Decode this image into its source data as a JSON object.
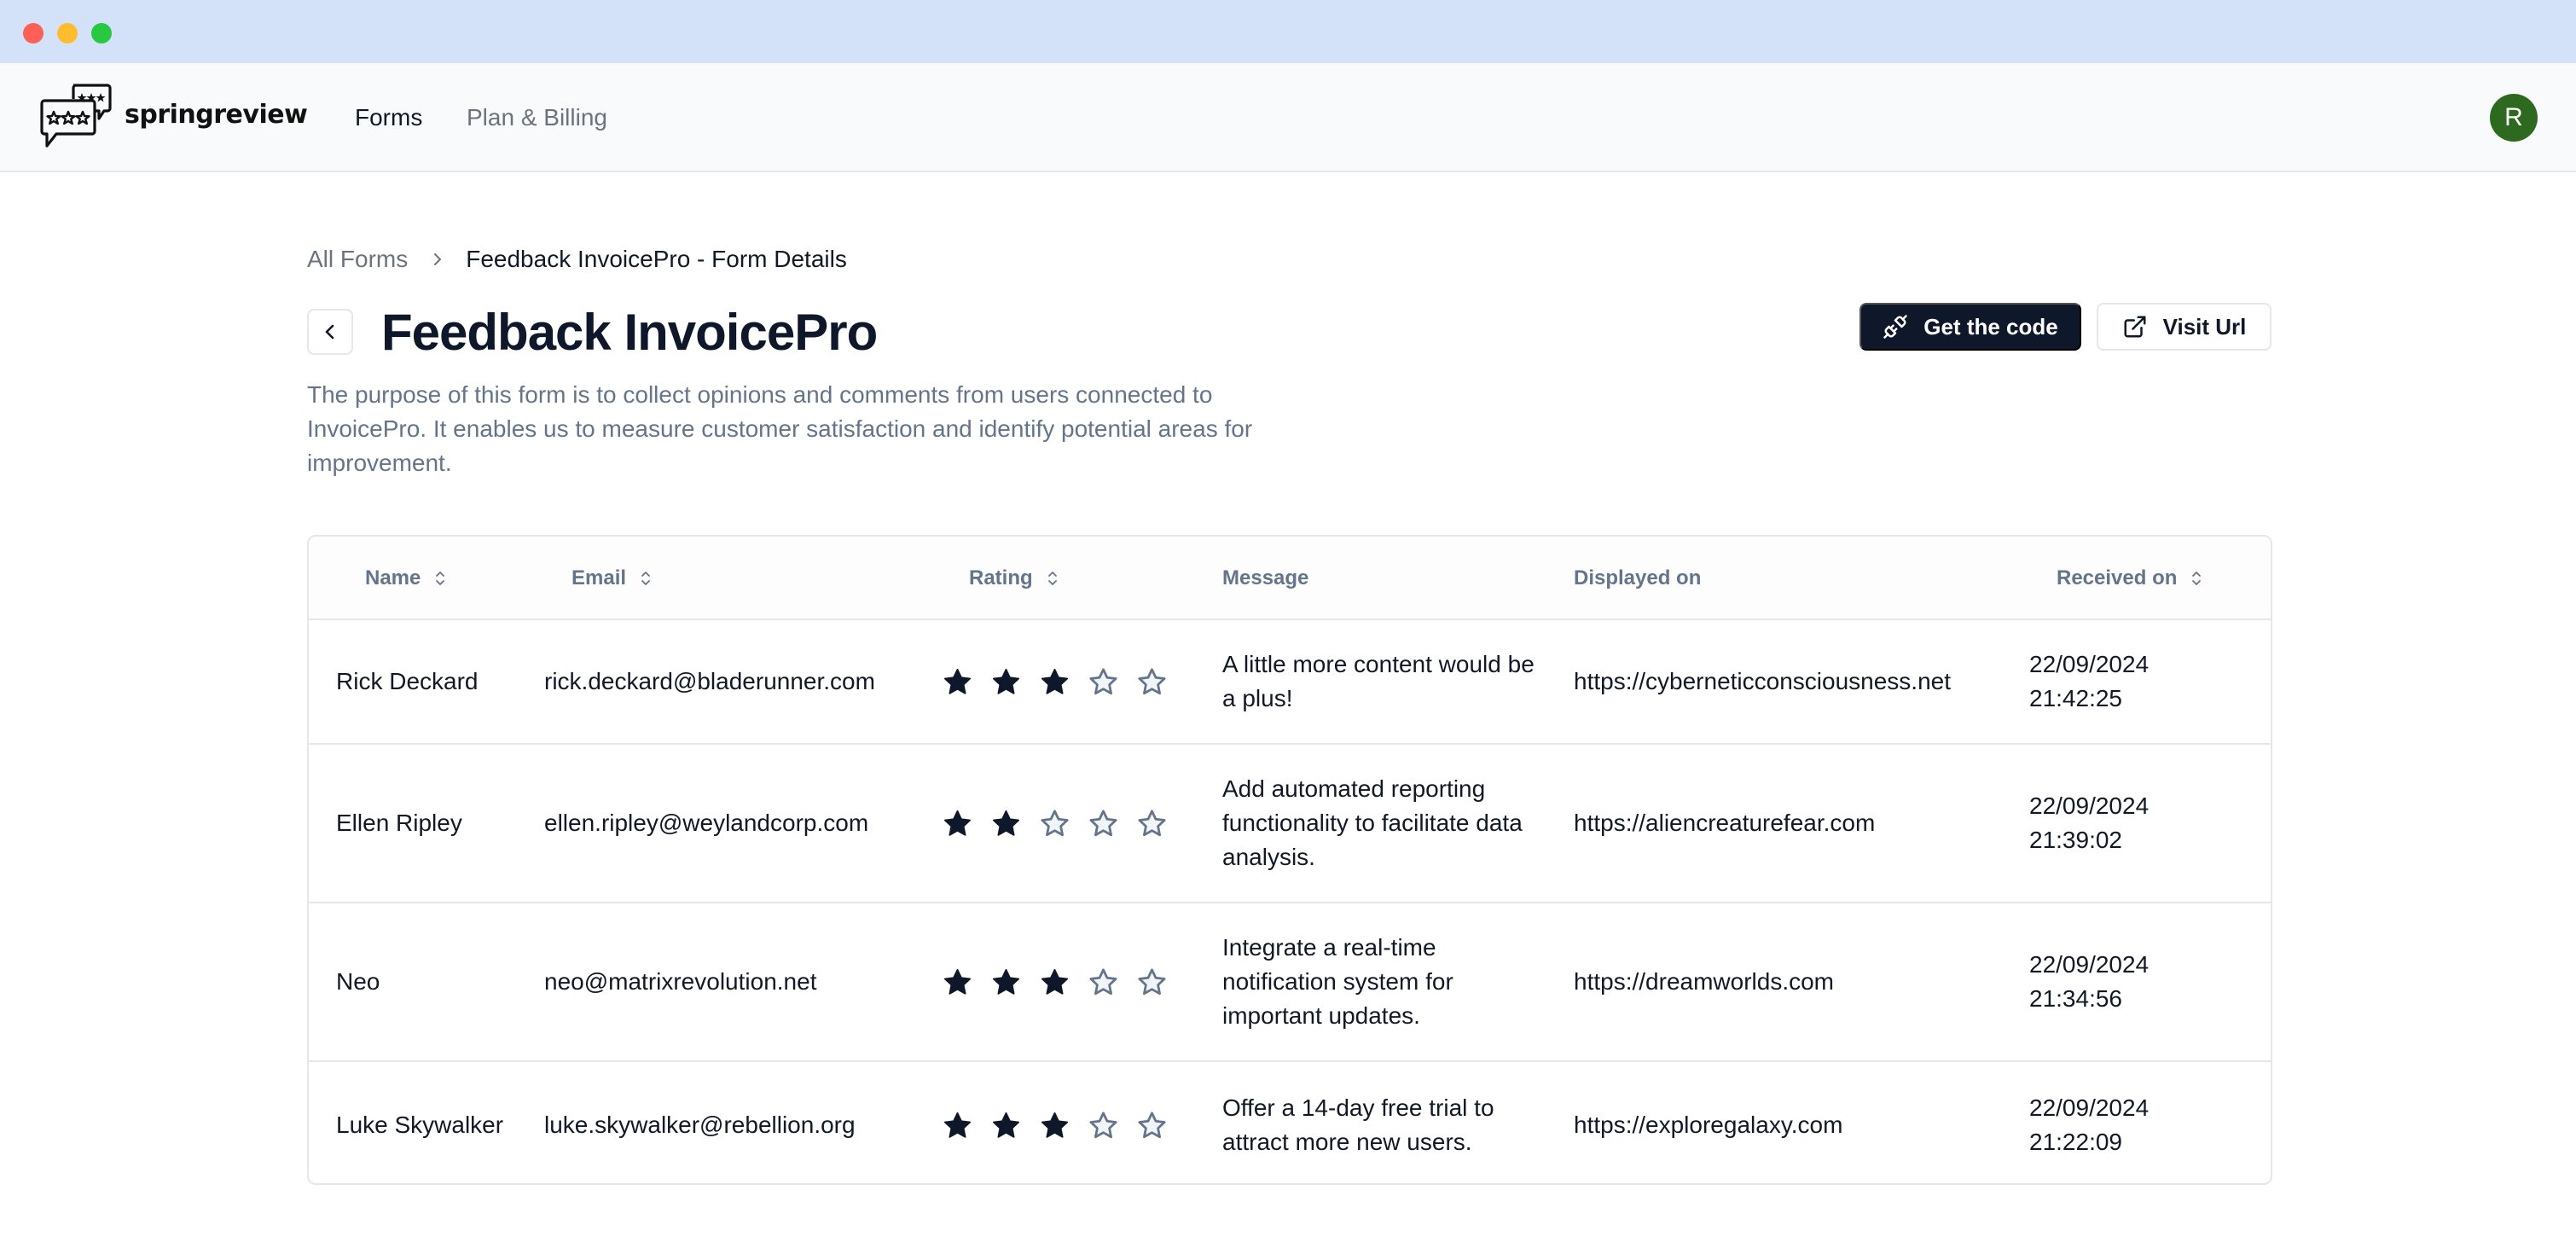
{
  "window": {
    "controls": [
      "close",
      "minimize",
      "maximize"
    ]
  },
  "nav": {
    "brand": "springreview",
    "links": [
      {
        "label": "Forms",
        "active": true
      },
      {
        "label": "Plan & Billing",
        "active": false
      }
    ],
    "avatar_initial": "R",
    "avatar_color": "#2d6a1f"
  },
  "breadcrumb": {
    "parent": "All Forms",
    "current": "Feedback InvoicePro - Form Details"
  },
  "page": {
    "title": "Feedback InvoicePro",
    "description": "The purpose of this form is to collect opinions and comments from users connected to InvoicePro. It enables us to measure customer satisfaction and identify potential areas for improvement.",
    "actions": {
      "get_code": "Get the code",
      "visit_url": "Visit Url"
    }
  },
  "table": {
    "columns": [
      {
        "label": "Name",
        "sortable": true
      },
      {
        "label": "Email",
        "sortable": true
      },
      {
        "label": "Rating",
        "sortable": true
      },
      {
        "label": "Message",
        "sortable": false
      },
      {
        "label": "Displayed on",
        "sortable": false
      },
      {
        "label": "Received on",
        "sortable": true
      }
    ],
    "rating_max": 5,
    "rows": [
      {
        "name": "Rick Deckard",
        "email": "rick.deckard@bladerunner.com",
        "rating": 3,
        "message": "A little more content would be a plus!",
        "displayed_on": "https://cyberneticconsciousness.net",
        "received_date": "22/09/2024",
        "received_time": "21:42:25"
      },
      {
        "name": "Ellen Ripley",
        "email": "ellen.ripley@weylandcorp.com",
        "rating": 2,
        "message": "Add automated reporting functionality to facilitate data analysis.",
        "displayed_on": "https://aliencreaturefear.com",
        "received_date": "22/09/2024",
        "received_time": "21:39:02"
      },
      {
        "name": "Neo",
        "email": "neo@matrixrevolution.net",
        "rating": 3,
        "message": "Integrate a real-time notification system for important updates.",
        "displayed_on": "https://dreamworlds.com",
        "received_date": "22/09/2024",
        "received_time": "21:34:56"
      },
      {
        "name": "Luke Skywalker",
        "email": "luke.skywalker@rebellion.org",
        "rating": 3,
        "message": "Offer a 14-day free trial to attract more new users.",
        "displayed_on": "https://exploregalaxy.com",
        "received_date": "22/09/2024",
        "received_time": "21:22:09"
      }
    ]
  },
  "colors": {
    "primary": "#0f172a",
    "muted_text": "#64748b",
    "star_filled": "#0f172a",
    "star_empty_stroke": "#64748b",
    "star_empty_fill": "#f1f5f9",
    "titlebar": "#d3e2f8"
  }
}
